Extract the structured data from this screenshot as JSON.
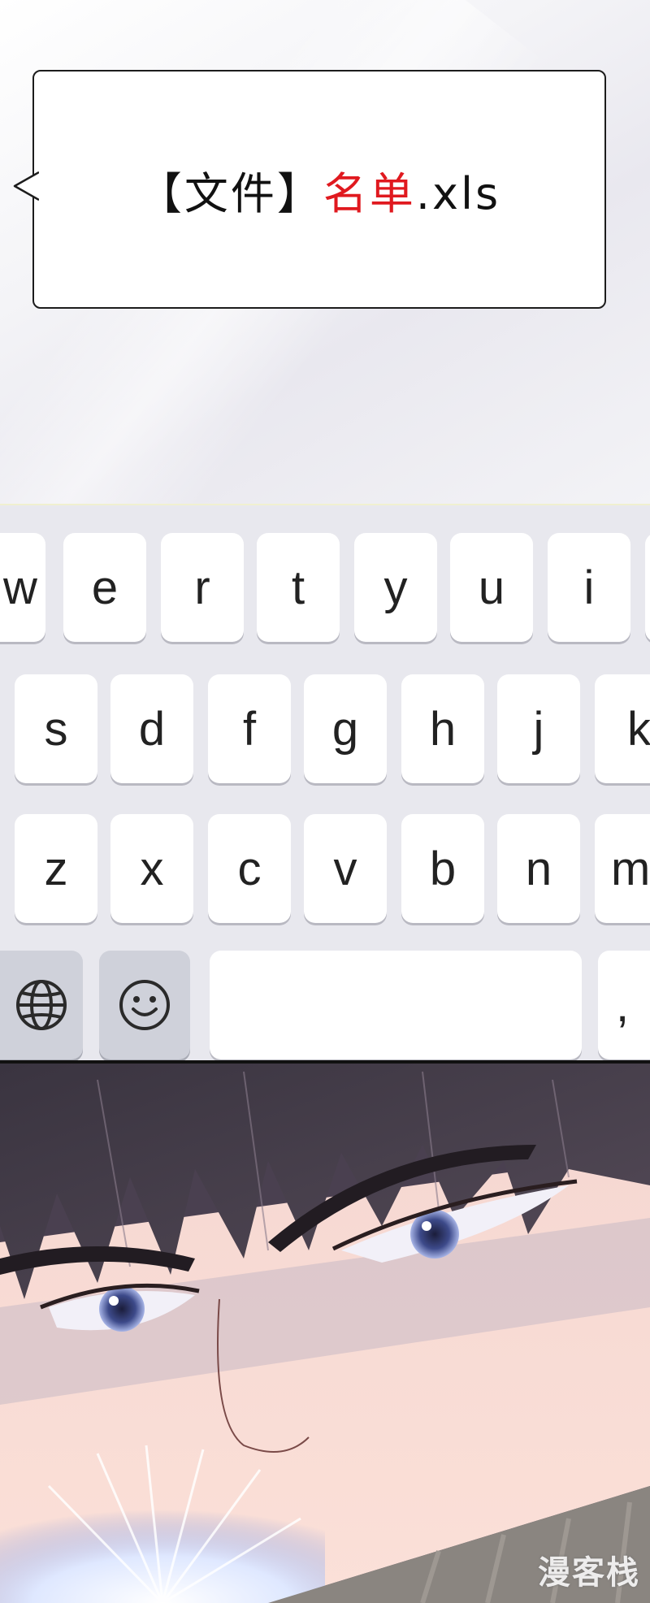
{
  "chat": {
    "bracket_open": "【",
    "file_tag": "文件",
    "bracket_close": "】",
    "filename": "名单",
    "extension": ".xls",
    "colors": {
      "text": "#111111",
      "highlight": "#e0191f"
    }
  },
  "keyboard": {
    "row1": [
      "w",
      "e",
      "r",
      "t",
      "y",
      "u",
      "i"
    ],
    "row2": [
      "s",
      "d",
      "f",
      "g",
      "h",
      "j",
      "k"
    ],
    "row3": [
      "z",
      "x",
      "c",
      "v",
      "b",
      "n",
      "m"
    ],
    "bottom": {
      "globe_icon": "globe-icon",
      "emoji_icon": "smiley-icon",
      "comma": ","
    }
  },
  "watermark": {
    "text": "漫客栈"
  }
}
